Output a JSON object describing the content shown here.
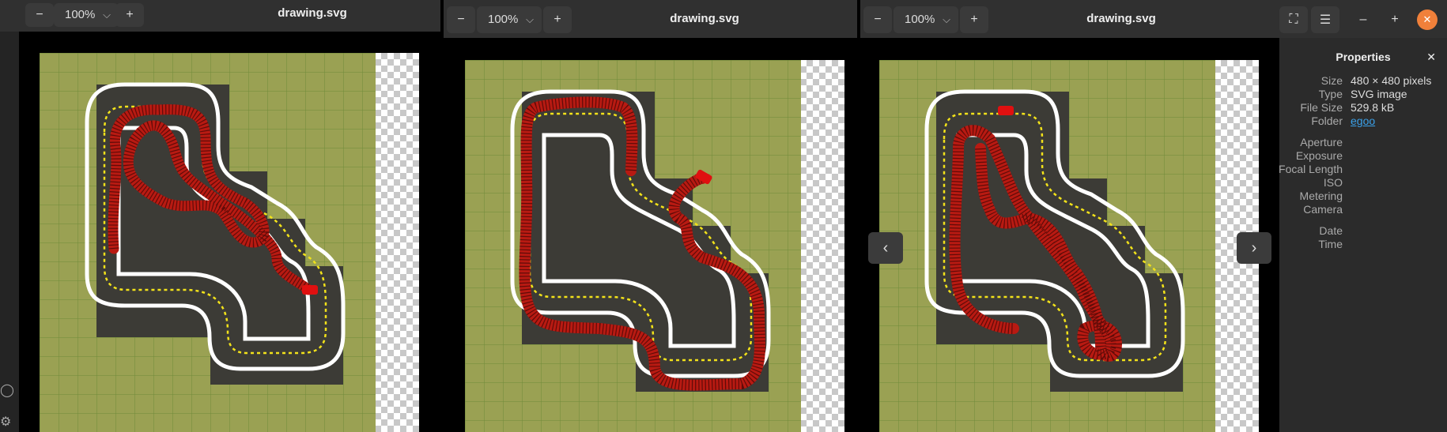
{
  "windows": [
    {
      "title": "drawing.svg",
      "zoom": "100%"
    },
    {
      "title": "drawing.svg",
      "zoom": "100%"
    },
    {
      "title": "drawing.svg",
      "zoom": "100%"
    }
  ],
  "icons": {
    "zoom_out": "−",
    "zoom_in": "+",
    "chevron": "⌵",
    "fullscreen": "⛶",
    "menu": "☰",
    "minimize": "–",
    "maximize": "+",
    "close": "✕",
    "prev": "‹",
    "next": "›"
  },
  "properties": {
    "header": "Properties",
    "close": "✕",
    "rows": [
      {
        "k": "Size",
        "v": "480 × 480 pixels"
      },
      {
        "k": "Type",
        "v": "SVG image"
      },
      {
        "k": "File Size",
        "v": "529.8 kB"
      },
      {
        "k": "Folder",
        "v": "egoo"
      },
      {
        "k": "Aperture",
        "v": ""
      },
      {
        "k": "Exposure",
        "v": ""
      },
      {
        "k": "Focal Length",
        "v": ""
      },
      {
        "k": "ISO",
        "v": ""
      },
      {
        "k": "Metering",
        "v": ""
      },
      {
        "k": "Camera",
        "v": ""
      },
      {
        "k": "Date",
        "v": ""
      },
      {
        "k": "Time",
        "v": ""
      }
    ]
  },
  "colors": {
    "grass": "#9aa153",
    "grid": "#6f8a3a",
    "track": "#3c3b36",
    "line_white": "#ffffff",
    "line_yellow": "#f2e21a",
    "path_red": "#b81a12",
    "accent_close": "#f0803a"
  }
}
